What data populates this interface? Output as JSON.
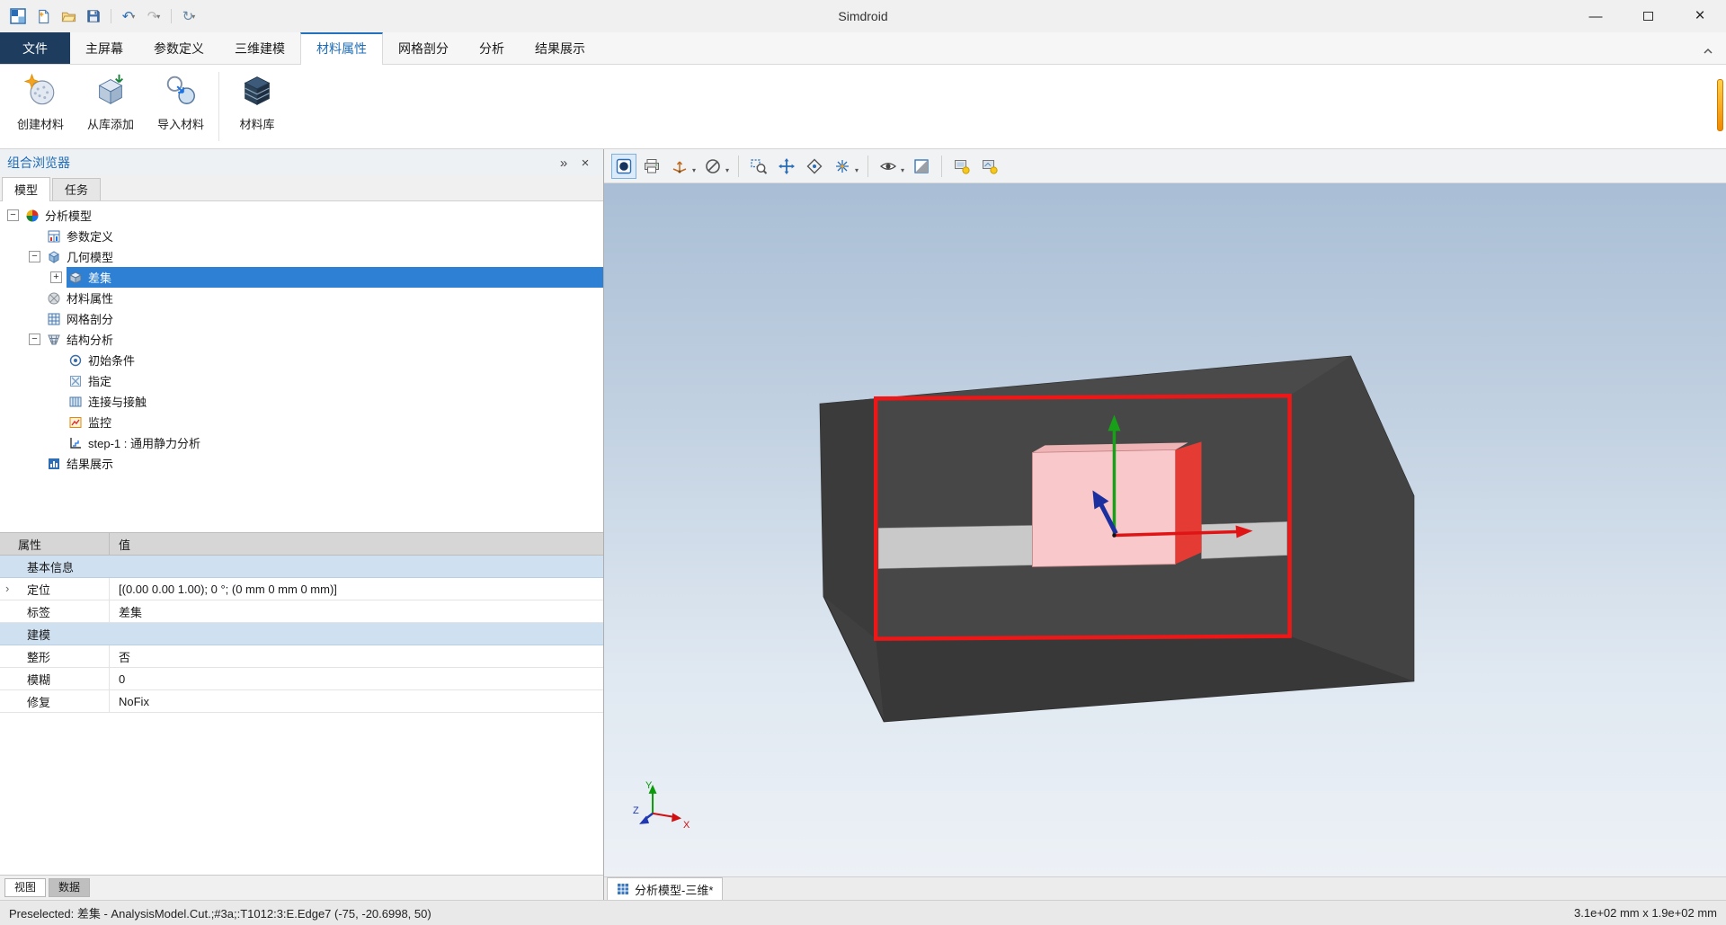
{
  "window": {
    "title": "Simdroid"
  },
  "colors": {
    "accent": "#2472bd",
    "selection": "#2e80d4",
    "file_tab": "#1d3c5e",
    "edge_highlight": "#ee1616"
  },
  "icons": {
    "undo": "↶",
    "redo": "↷",
    "refresh": "↻",
    "caret": "▾",
    "collapse_panel": "»",
    "close_panel": "×",
    "minimize": "—",
    "close": "×",
    "expand_plus": "+",
    "expand_minus": "−",
    "row_chevron": "›"
  },
  "ribbon_tabs": [
    {
      "label": "文件"
    },
    {
      "label": "主屏幕"
    },
    {
      "label": "参数定义"
    },
    {
      "label": "三维建模"
    },
    {
      "label": "材料属性"
    },
    {
      "label": "网格剖分"
    },
    {
      "label": "分析"
    },
    {
      "label": "结果展示"
    }
  ],
  "ribbon_buttons": [
    {
      "label": "创建材料"
    },
    {
      "label": "从库添加"
    },
    {
      "label": "导入材料"
    },
    {
      "label": "材料库"
    }
  ],
  "browser": {
    "title": "组合浏览器",
    "tabs": [
      {
        "label": "模型"
      },
      {
        "label": "任务"
      }
    ],
    "tree": [
      {
        "label": "分析模型"
      },
      {
        "label": "参数定义"
      },
      {
        "label": "几何模型"
      },
      {
        "label": "差集"
      },
      {
        "label": "材料属性"
      },
      {
        "label": "网格剖分"
      },
      {
        "label": "结构分析"
      },
      {
        "label": "初始条件"
      },
      {
        "label": "指定"
      },
      {
        "label": "连接与接触"
      },
      {
        "label": "监控"
      },
      {
        "label": "step-1 : 通用静力分析"
      },
      {
        "label": "结果展示"
      }
    ]
  },
  "properties": {
    "col_property": "属性",
    "col_value": "值",
    "rows": [
      {
        "label": "基本信息",
        "value": ""
      },
      {
        "label": "定位",
        "value": "[(0.00 0.00 1.00); 0 °; (0 mm  0 mm  0 mm)]"
      },
      {
        "label": "标签",
        "value": "差集"
      },
      {
        "label": "建模",
        "value": ""
      },
      {
        "label": "整形",
        "value": "否"
      },
      {
        "label": "模糊",
        "value": "0"
      },
      {
        "label": "修复",
        "value": "NoFix"
      }
    ]
  },
  "panel_bottom_tabs": [
    {
      "label": "视图"
    },
    {
      "label": "数据"
    }
  ],
  "viewport": {
    "tab_label": "分析模型-三维*",
    "triad": {
      "x": "X",
      "y": "Y",
      "z": "Z"
    }
  },
  "statusbar": {
    "left": "Preselected: 差集 - AnalysisModel.Cut.;#3a;:T1012:3:E.Edge7 (-75, -20.6998, 50)",
    "right": "3.1e+02 mm x 1.9e+02 mm"
  }
}
